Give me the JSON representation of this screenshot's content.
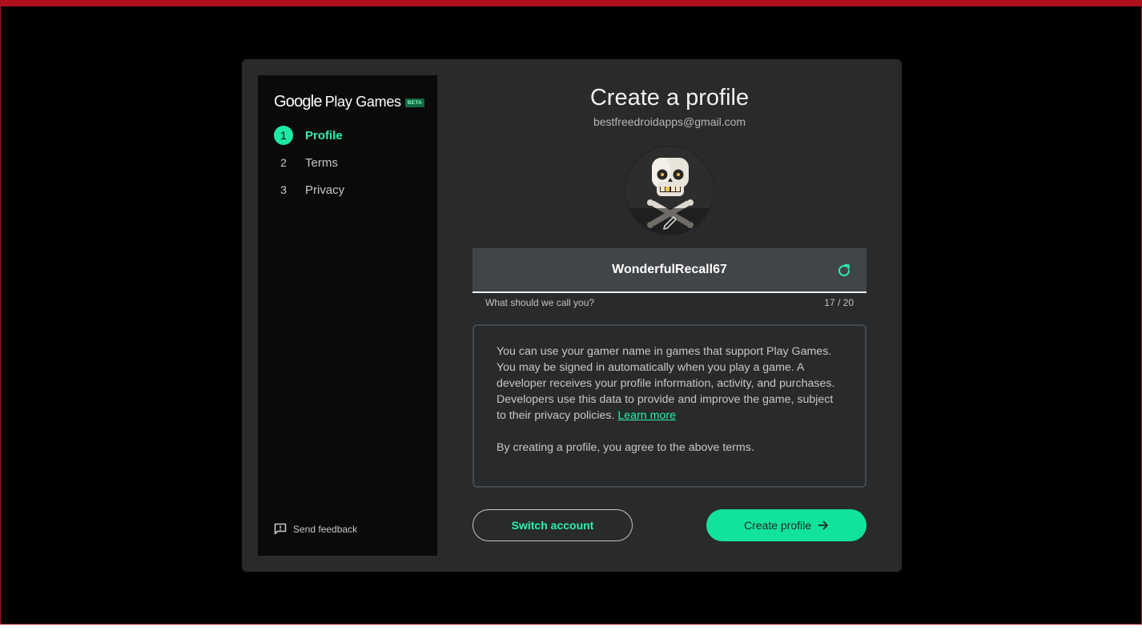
{
  "colors": {
    "accent": "#1de9a4",
    "window_border": "#b0101e",
    "dialog_bg": "#292a2c",
    "sidebar_bg": "#0a0a0a"
  },
  "brand": {
    "google": "Google",
    "product": "Play Games",
    "badge": "BETA"
  },
  "steps": [
    {
      "num": "1",
      "label": "Profile",
      "active": true
    },
    {
      "num": "2",
      "label": "Terms",
      "active": false
    },
    {
      "num": "3",
      "label": "Privacy",
      "active": false
    }
  ],
  "feedback": {
    "label": "Send feedback",
    "icon": "feedback-icon"
  },
  "profile": {
    "title": "Create a profile",
    "email": "bestfreedroidapps@gmail.com",
    "avatar_icon": "skull-crossbones-avatar",
    "edit_icon": "pencil-icon"
  },
  "name_field": {
    "value": "WonderfulRecall67",
    "helper": "What should we call you?",
    "count": "17 / 20",
    "refresh_icon": "refresh-icon"
  },
  "terms": {
    "paragraph1": "You can use your gamer name in games that support Play Games. You may be signed in automatically when you play a game. A developer receives your profile information, activity, and purchases. Developers use this data to provide and improve the game, subject to their privacy policies.",
    "learn_more": "Learn more",
    "paragraph2": "By creating a profile, you agree to the above terms."
  },
  "buttons": {
    "switch_account": "Switch account",
    "create_profile": "Create profile",
    "arrow_icon": "arrow-right-icon"
  }
}
